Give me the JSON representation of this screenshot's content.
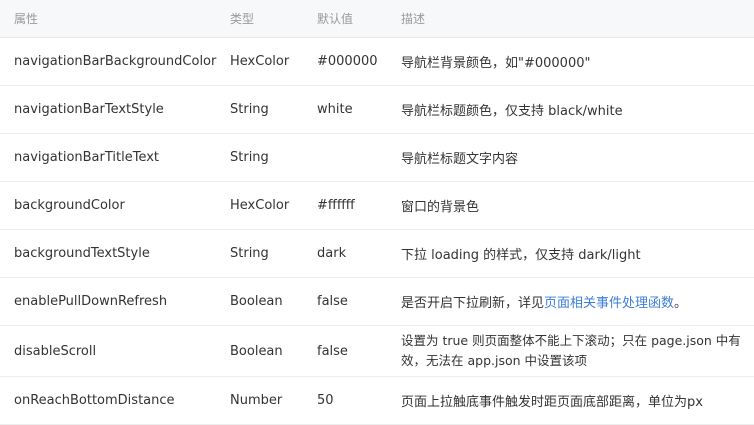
{
  "table": {
    "headers": [
      "属性",
      "类型",
      "默认值",
      "描述"
    ],
    "rows": [
      {
        "name": "navigationBarBackgroundColor",
        "type": "HexColor",
        "default": "#000000",
        "desc": "导航栏背景颜色，如\"#000000\""
      },
      {
        "name": "navigationBarTextStyle",
        "type": "String",
        "default": "white",
        "desc": "导航栏标题颜色，仅支持 black/white"
      },
      {
        "name": "navigationBarTitleText",
        "type": "String",
        "default": "",
        "desc": "导航栏标题文字内容"
      },
      {
        "name": "backgroundColor",
        "type": "HexColor",
        "default": "#ffffff",
        "desc": "窗口的背景色"
      },
      {
        "name": "backgroundTextStyle",
        "type": "String",
        "default": "dark",
        "desc": "下拉 loading 的样式，仅支持 dark/light"
      },
      {
        "name": "enablePullDownRefresh",
        "type": "Boolean",
        "default": "false",
        "desc_prefix": "是否开启下拉刷新，详见",
        "desc_link": "页面相关事件处理函数",
        "desc_suffix": "。"
      },
      {
        "name": "disableScroll",
        "type": "Boolean",
        "default": "false",
        "desc": "设置为 true 则页面整体不能上下滚动；只在 page.json 中有效，无法在 app.json 中设置该项"
      },
      {
        "name": "onReachBottomDistance",
        "type": "Number",
        "default": "50",
        "desc": "页面上拉触底事件触发时距页面底部距离，单位为px"
      }
    ]
  },
  "colors": {
    "link": "#3b7dd8",
    "header_bg": "#f7f8fa"
  }
}
